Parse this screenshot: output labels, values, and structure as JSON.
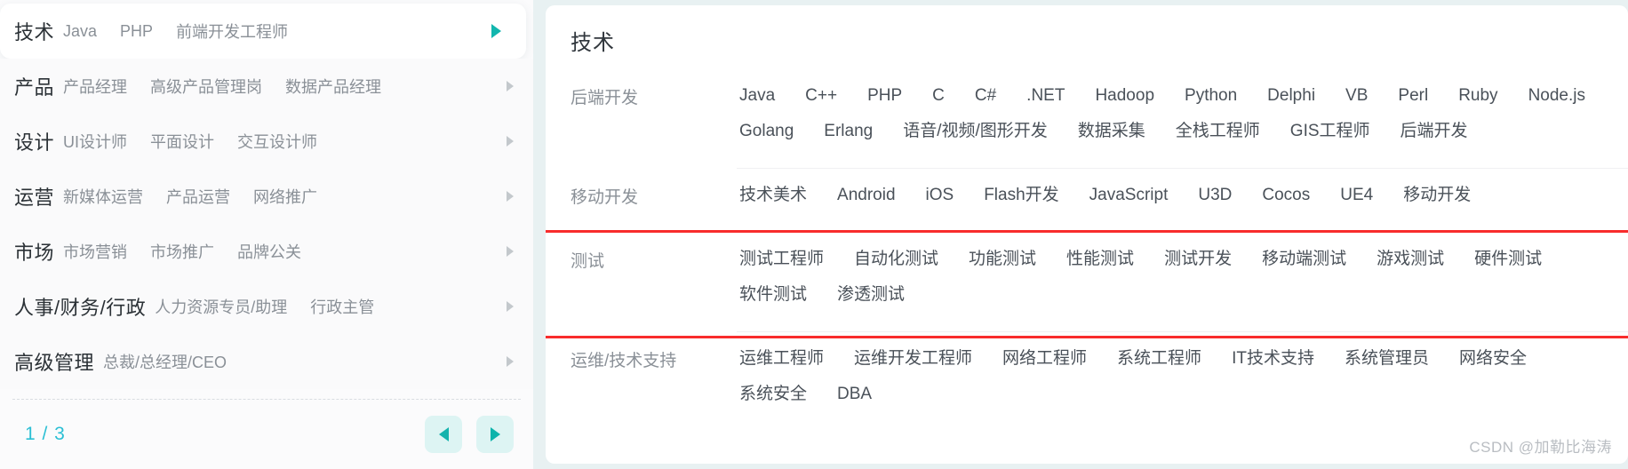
{
  "left_panel": {
    "categories": [
      {
        "name": "技术",
        "tags": [
          "Java",
          "PHP",
          "前端开发工程师"
        ],
        "active": true
      },
      {
        "name": "产品",
        "tags": [
          "产品经理",
          "高级产品管理岗",
          "数据产品经理"
        ],
        "active": false
      },
      {
        "name": "设计",
        "tags": [
          "UI设计师",
          "平面设计",
          "交互设计师"
        ],
        "active": false
      },
      {
        "name": "运营",
        "tags": [
          "新媒体运营",
          "产品运营",
          "网络推广"
        ],
        "active": false
      },
      {
        "name": "市场",
        "tags": [
          "市场营销",
          "市场推广",
          "品牌公关"
        ],
        "active": false
      },
      {
        "name": "人事/财务/行政",
        "tags": [
          "人力资源专员/助理",
          "行政主管"
        ],
        "active": false
      },
      {
        "name": "高级管理",
        "tags": [
          "总裁/总经理/CEO"
        ],
        "active": false
      }
    ],
    "pagination": {
      "count_label": "1 / 3",
      "prev_icon": "triangle-left-icon",
      "next_icon": "triangle-right-icon"
    },
    "row_arrow_icon": "chevron-right-icon"
  },
  "right_panel": {
    "title": "技术",
    "groups": [
      {
        "name": "后端开发",
        "items": [
          "Java",
          "C++",
          "PHP",
          "C",
          "C#",
          ".NET",
          "Hadoop",
          "Python",
          "Delphi",
          "VB",
          "Perl",
          "Ruby",
          "Node.js",
          "Golang",
          "Erlang",
          "语音/视频/图形开发",
          "数据采集",
          "全栈工程师",
          "GIS工程师",
          "后端开发"
        ],
        "highlighted": false
      },
      {
        "name": "移动开发",
        "items": [
          "技术美术",
          "Android",
          "iOS",
          "Flash开发",
          "JavaScript",
          "U3D",
          "Cocos",
          "UE4",
          "移动开发"
        ],
        "highlighted": false
      },
      {
        "name": "测试",
        "items": [
          "测试工程师",
          "自动化测试",
          "功能测试",
          "性能测试",
          "测试开发",
          "移动端测试",
          "游戏测试",
          "硬件测试",
          "软件测试",
          "渗透测试"
        ],
        "highlighted": true
      },
      {
        "name": "运维/技术支持",
        "items": [
          "运维工程师",
          "运维开发工程师",
          "网络工程师",
          "系统工程师",
          "IT技术支持",
          "系统管理员",
          "网络安全",
          "系统安全",
          "DBA"
        ],
        "highlighted": false
      }
    ]
  },
  "watermark": {
    "text": "CSDN @加勒比海涛"
  },
  "colors": {
    "accent_teal": "#12b6ae",
    "pager_text": "#2bbfd4",
    "highlight_red": "#f82c2c",
    "page_bg": "#e8f1f2",
    "panel_bg": "#ffffff"
  }
}
